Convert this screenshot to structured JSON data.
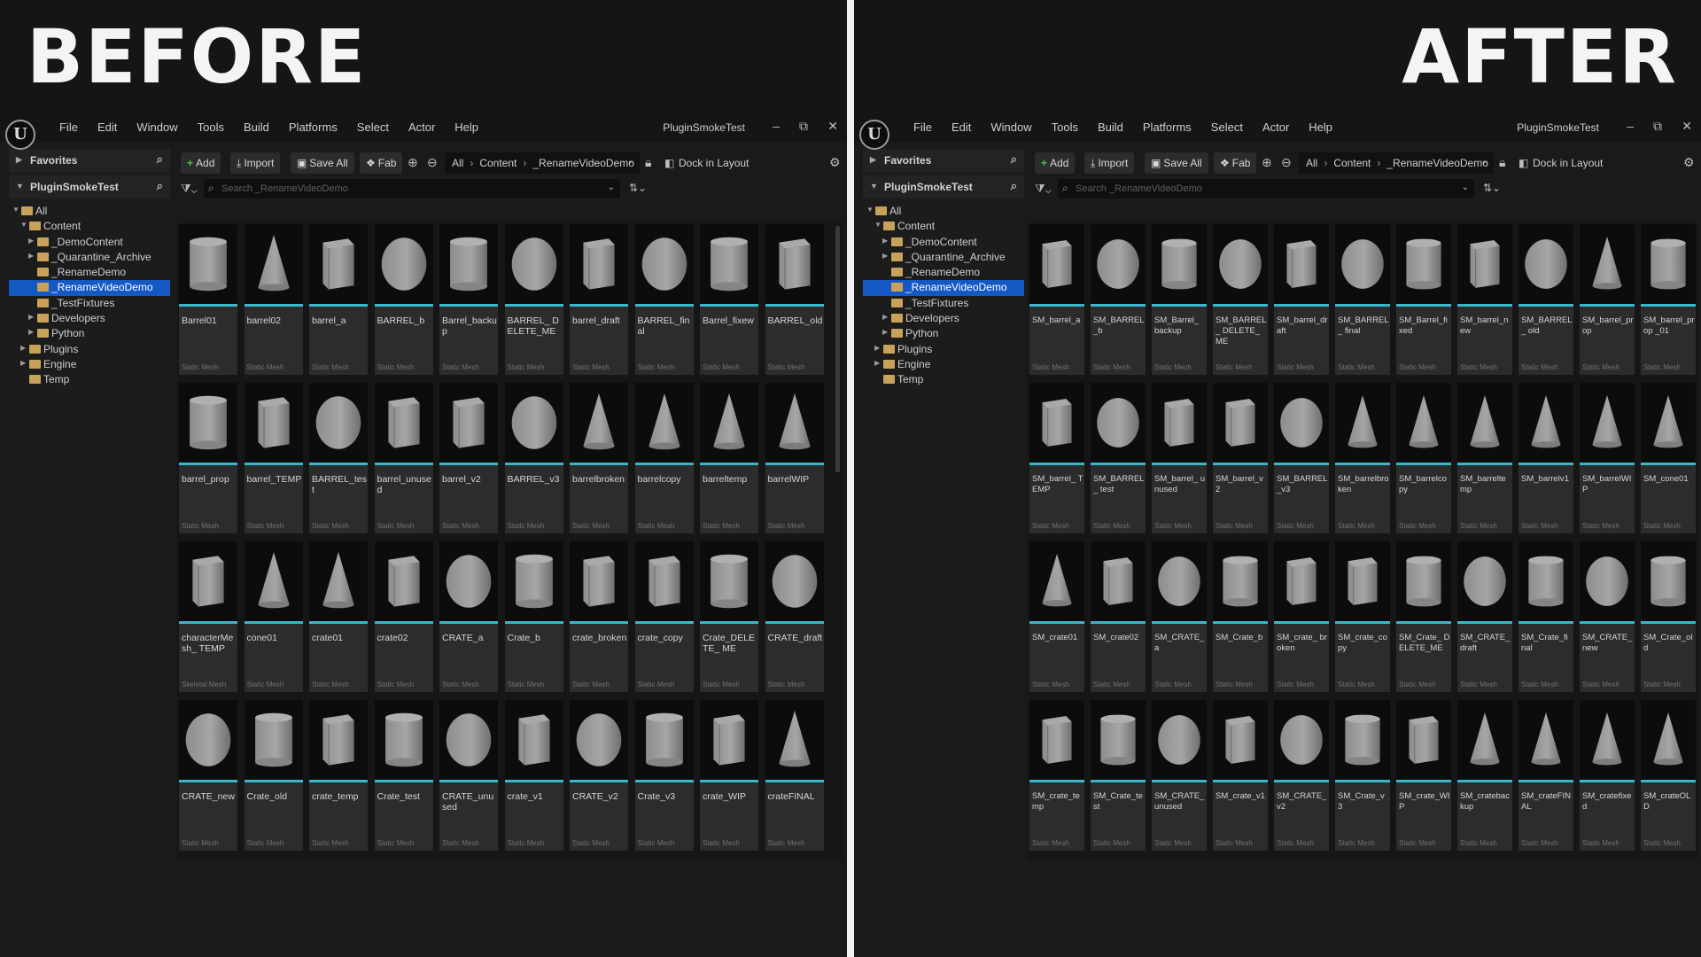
{
  "colors": {
    "selection": "#1458c4",
    "thumb_underline": "#3ab7c9",
    "add_icon": "#4fc04f",
    "folder": "#c8a25a"
  },
  "menu": [
    "File",
    "Edit",
    "Window",
    "Tools",
    "Build",
    "Platforms",
    "Select",
    "Actor",
    "Help"
  ],
  "project_name": "PluginSmokeTest",
  "window_controls": {
    "minimize": "–",
    "restore": "⧉",
    "close": "✕"
  },
  "toolbar": {
    "add": "Add",
    "import": "Import",
    "save_all": "Save All",
    "fab": "Fab",
    "breadcrumb": [
      "All",
      "Content",
      "_RenameVideoDemo"
    ],
    "dock": "Dock in Layout"
  },
  "search_placeholder": "Search _RenameVideoDemo",
  "sidebar": {
    "favorites": "Favorites",
    "project": "PluginSmokeTest",
    "tree": [
      {
        "label": "All",
        "depth": 0,
        "expanded": true
      },
      {
        "label": "Content",
        "depth": 1,
        "expanded": true
      },
      {
        "label": "_DemoContent",
        "depth": 2,
        "expanded": false
      },
      {
        "label": "_Quarantine_Archive",
        "depth": 2,
        "expanded": false
      },
      {
        "label": "_RenameDemo",
        "depth": 2,
        "leaf": true
      },
      {
        "label": "_RenameVideoDemo",
        "depth": 2,
        "leaf": true,
        "selected": true
      },
      {
        "label": "_TestFixtures",
        "depth": 2,
        "leaf": true
      },
      {
        "label": "Developers",
        "depth": 2,
        "expanded": false
      },
      {
        "label": "Python",
        "depth": 2,
        "expanded": false
      },
      {
        "label": "Plugins",
        "depth": 1,
        "expanded": false
      },
      {
        "label": "Engine",
        "depth": 1,
        "expanded": false
      },
      {
        "label": "Temp",
        "depth": 1,
        "leaf": true
      }
    ]
  },
  "before": {
    "title": "BEFORE",
    "assets": [
      {
        "name": "Barrel01",
        "type": "Static Mesh",
        "shape": "cylinder"
      },
      {
        "name": "barrel02",
        "type": "Static Mesh",
        "shape": "cone"
      },
      {
        "name": "barrel_a",
        "type": "Static Mesh",
        "shape": "box"
      },
      {
        "name": "BARREL_b",
        "type": "Static Mesh",
        "shape": "sphere"
      },
      {
        "name": "Barrel_backup",
        "type": "Static Mesh",
        "shape": "cylinder"
      },
      {
        "name": "BARREL_ DELETE_ME",
        "type": "Static Mesh",
        "shape": "sphere"
      },
      {
        "name": "barrel_draft",
        "type": "Static Mesh",
        "shape": "box"
      },
      {
        "name": "BARREL_final",
        "type": "Static Mesh",
        "shape": "sphere"
      },
      {
        "name": "Barrel_fixew",
        "type": "Static Mesh",
        "shape": "cylinder"
      },
      {
        "name": "BARREL_old",
        "type": "Static Mesh",
        "shape": "box"
      },
      {
        "name": "barrel_prop",
        "type": "Static Mesh",
        "shape": "cylinder"
      },
      {
        "name": "barrel_TEMP",
        "type": "Static Mesh",
        "shape": "box"
      },
      {
        "name": "BARREL_test",
        "type": "Static Mesh",
        "shape": "sphere"
      },
      {
        "name": "barrel_unused",
        "type": "Static Mesh",
        "shape": "box"
      },
      {
        "name": "barrel_v2",
        "type": "Static Mesh",
        "shape": "box"
      },
      {
        "name": "BARREL_v3",
        "type": "Static Mesh",
        "shape": "sphere"
      },
      {
        "name": "barrelbroken",
        "type": "Static Mesh",
        "shape": "cone"
      },
      {
        "name": "barrelcopy",
        "type": "Static Mesh",
        "shape": "cone"
      },
      {
        "name": "barreltemp",
        "type": "Static Mesh",
        "shape": "cone"
      },
      {
        "name": "barrelWIP",
        "type": "Static Mesh",
        "shape": "cone"
      },
      {
        "name": "characterMesh_ TEMP",
        "type": "Skeletal Mesh",
        "shape": "box"
      },
      {
        "name": "cone01",
        "type": "Static Mesh",
        "shape": "cone"
      },
      {
        "name": "crate01",
        "type": "Static Mesh",
        "shape": "cone"
      },
      {
        "name": "crate02",
        "type": "Static Mesh",
        "shape": "box"
      },
      {
        "name": "CRATE_a",
        "type": "Static Mesh",
        "shape": "sphere"
      },
      {
        "name": "Crate_b",
        "type": "Static Mesh",
        "shape": "cylinder"
      },
      {
        "name": "crate_broken",
        "type": "Static Mesh",
        "shape": "box"
      },
      {
        "name": "crate_copy",
        "type": "Static Mesh",
        "shape": "box"
      },
      {
        "name": "Crate_DELETE_ ME",
        "type": "Static Mesh",
        "shape": "cylinder"
      },
      {
        "name": "CRATE_draft",
        "type": "Static Mesh",
        "shape": "sphere"
      },
      {
        "name": "CRATE_new",
        "type": "Static Mesh",
        "shape": "sphere"
      },
      {
        "name": "Crate_old",
        "type": "Static Mesh",
        "shape": "cylinder"
      },
      {
        "name": "crate_temp",
        "type": "Static Mesh",
        "shape": "box"
      },
      {
        "name": "Crate_test",
        "type": "Static Mesh",
        "shape": "cylinder"
      },
      {
        "name": "CRATE_unused",
        "type": "Static Mesh",
        "shape": "sphere"
      },
      {
        "name": "crate_v1",
        "type": "Static Mesh",
        "shape": "box"
      },
      {
        "name": "CRATE_v2",
        "type": "Static Mesh",
        "shape": "sphere"
      },
      {
        "name": "Crate_v3",
        "type": "Static Mesh",
        "shape": "cylinder"
      },
      {
        "name": "crate_WIP",
        "type": "Static Mesh",
        "shape": "box"
      },
      {
        "name": "crateFINAL",
        "type": "Static Mesh",
        "shape": "cone"
      }
    ]
  },
  "after": {
    "title": "AFTER",
    "assets": [
      {
        "name": "SM_barrel_a",
        "type": "Static Mesh",
        "shape": "box"
      },
      {
        "name": "SM_BARREL_b",
        "type": "Static Mesh",
        "shape": "sphere"
      },
      {
        "name": "SM_Barrel_ backup",
        "type": "Static Mesh",
        "shape": "cylinder"
      },
      {
        "name": "SM_BARREL_ DELETE_ME",
        "type": "Static Mesh",
        "shape": "sphere"
      },
      {
        "name": "SM_barrel_draft",
        "type": "Static Mesh",
        "shape": "box"
      },
      {
        "name": "SM_BARREL_ final",
        "type": "Static Mesh",
        "shape": "sphere"
      },
      {
        "name": "SM_Barrel_fixed",
        "type": "Static Mesh",
        "shape": "cylinder"
      },
      {
        "name": "SM_barrel_new",
        "type": "Static Mesh",
        "shape": "box"
      },
      {
        "name": "SM_BARREL_ old",
        "type": "Static Mesh",
        "shape": "sphere"
      },
      {
        "name": "SM_barrel_prop",
        "type": "Static Mesh",
        "shape": "cone"
      },
      {
        "name": "SM_barrel_prop _01",
        "type": "Static Mesh",
        "shape": "cylinder"
      },
      {
        "name": "SM_barrel_ TEMP",
        "type": "Static Mesh",
        "shape": "box"
      },
      {
        "name": "SM_BARREL_ test",
        "type": "Static Mesh",
        "shape": "sphere"
      },
      {
        "name": "SM_barrel_ unused",
        "type": "Static Mesh",
        "shape": "box"
      },
      {
        "name": "SM_barrel_v2",
        "type": "Static Mesh",
        "shape": "box"
      },
      {
        "name": "SM_BARREL_v3",
        "type": "Static Mesh",
        "shape": "sphere"
      },
      {
        "name": "SM_barrelbroken",
        "type": "Static Mesh",
        "shape": "cone"
      },
      {
        "name": "SM_barrelcopy",
        "type": "Static Mesh",
        "shape": "cone"
      },
      {
        "name": "SM_barreltemp",
        "type": "Static Mesh",
        "shape": "cone"
      },
      {
        "name": "SM_barrelv1",
        "type": "Static Mesh",
        "shape": "cone"
      },
      {
        "name": "SM_barrelWIP",
        "type": "Static Mesh",
        "shape": "cone"
      },
      {
        "name": "SM_cone01",
        "type": "Static Mesh",
        "shape": "cone"
      },
      {
        "name": "SM_crate01",
        "type": "Static Mesh",
        "shape": "cone"
      },
      {
        "name": "SM_crate02",
        "type": "Static Mesh",
        "shape": "box"
      },
      {
        "name": "SM_CRATE_a",
        "type": "Static Mesh",
        "shape": "sphere"
      },
      {
        "name": "SM_Crate_b",
        "type": "Static Mesh",
        "shape": "cylinder"
      },
      {
        "name": "SM_crate_ broken",
        "type": "Static Mesh",
        "shape": "box"
      },
      {
        "name": "SM_crate_copy",
        "type": "Static Mesh",
        "shape": "box"
      },
      {
        "name": "SM_Crate_ DELETE_ME",
        "type": "Static Mesh",
        "shape": "cylinder"
      },
      {
        "name": "SM_CRATE_ draft",
        "type": "Static Mesh",
        "shape": "sphere"
      },
      {
        "name": "SM_Crate_final",
        "type": "Static Mesh",
        "shape": "cylinder"
      },
      {
        "name": "SM_CRATE_new",
        "type": "Static Mesh",
        "shape": "sphere"
      },
      {
        "name": "SM_Crate_old",
        "type": "Static Mesh",
        "shape": "cylinder"
      },
      {
        "name": "SM_crate_temp",
        "type": "Static Mesh",
        "shape": "box"
      },
      {
        "name": "SM_Crate_test",
        "type": "Static Mesh",
        "shape": "cylinder"
      },
      {
        "name": "SM_CRATE_ unused",
        "type": "Static Mesh",
        "shape": "sphere"
      },
      {
        "name": "SM_crate_v1",
        "type": "Static Mesh",
        "shape": "box"
      },
      {
        "name": "SM_CRATE_v2",
        "type": "Static Mesh",
        "shape": "sphere"
      },
      {
        "name": "SM_Crate_v3",
        "type": "Static Mesh",
        "shape": "cylinder"
      },
      {
        "name": "SM_crate_WIP",
        "type": "Static Mesh",
        "shape": "box"
      },
      {
        "name": "SM_cratebackup",
        "type": "Static Mesh",
        "shape": "cone"
      },
      {
        "name": "SM_crateFINAL",
        "type": "Static Mesh",
        "shape": "cone"
      },
      {
        "name": "SM_cratefixed",
        "type": "Static Mesh",
        "shape": "cone"
      },
      {
        "name": "SM_crateOLD",
        "type": "Static Mesh",
        "shape": "cone"
      }
    ]
  }
}
